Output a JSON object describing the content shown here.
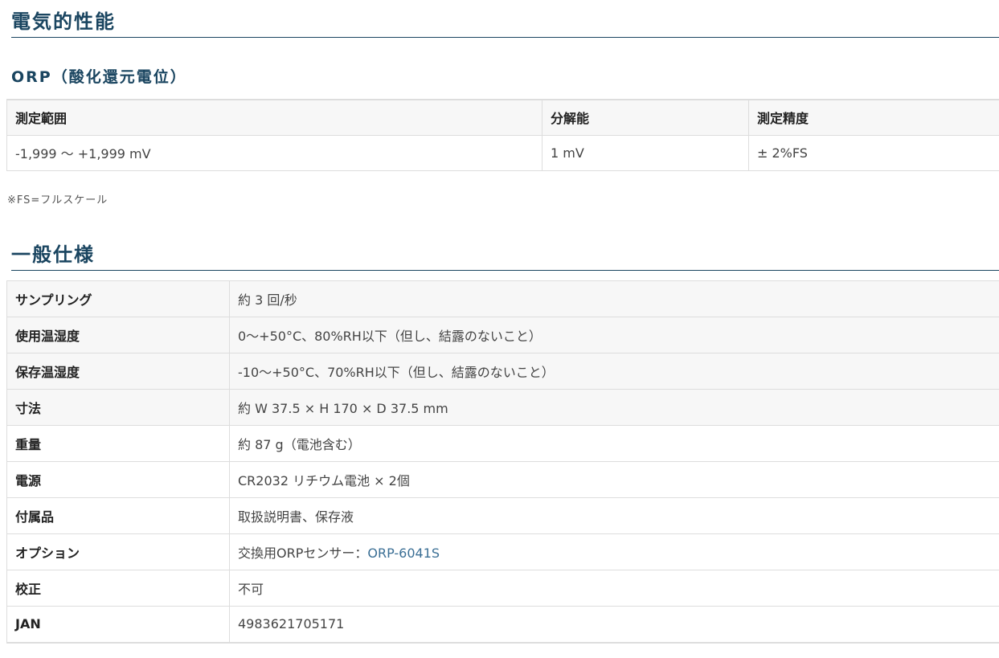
{
  "sections": {
    "electrical_title": "電気的性能",
    "general_title": "一般仕様"
  },
  "orp": {
    "title": "ORP（酸化還元電位）",
    "headers": [
      "測定範囲",
      "分解能",
      "測定精度"
    ],
    "values": [
      "-1,999 〜 +1,999 mV",
      "1 mV",
      "± 2%FS"
    ],
    "note": "※FS=フルスケール"
  },
  "specs": [
    {
      "label": "サンプリング",
      "value": "約 3 回/秒"
    },
    {
      "label": "使用温湿度",
      "value": "0〜+50°C、80%RH以下（但し、結露のないこと）"
    },
    {
      "label": "保存温湿度",
      "value": "-10〜+50°C、70%RH以下（但し、結露のないこと）"
    },
    {
      "label": "寸法",
      "value": "約 W 37.5 × H 170 × D 37.5 mm"
    },
    {
      "label": "重量",
      "value": "約 87 g（電池含む）"
    },
    {
      "label": "電源",
      "value": "CR2032 リチウム電池 × 2個"
    },
    {
      "label": "付属品",
      "value": "取扱説明書、保存液"
    },
    {
      "label": "オプション",
      "value_prefix": "交換用ORPセンサー：",
      "link": "ORP-6041S"
    },
    {
      "label": "校正",
      "value": "不可"
    },
    {
      "label": "JAN",
      "value": "4983621705171"
    }
  ]
}
